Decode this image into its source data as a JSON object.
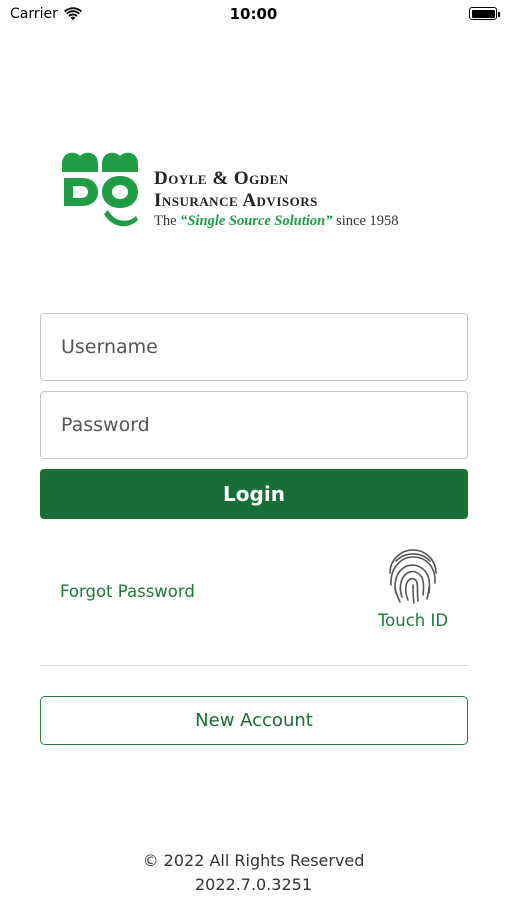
{
  "status_bar": {
    "carrier": "Carrier",
    "time": "10:00",
    "icons": [
      "wifi-icon",
      "battery-icon"
    ]
  },
  "logo": {
    "line1": "Doyle & Ogden",
    "line2": "Insurance Advisors",
    "tagline_prefix": "The ",
    "tagline_accent": "“Single Source Solution”",
    "tagline_suffix": " since 1958",
    "brand_color": "#1f9c45"
  },
  "form": {
    "username_placeholder": "Username",
    "password_placeholder": "Password",
    "login_label": "Login",
    "forgot_password_label": "Forgot Password",
    "touch_id_label": "Touch ID",
    "new_account_label": "New Account"
  },
  "footer": {
    "copyright": "© 2022 All Rights Reserved",
    "version": "2022.7.0.3251"
  },
  "colors": {
    "primary": "#186f35",
    "link": "#1b7a3b",
    "border": "#c8c8c8"
  }
}
